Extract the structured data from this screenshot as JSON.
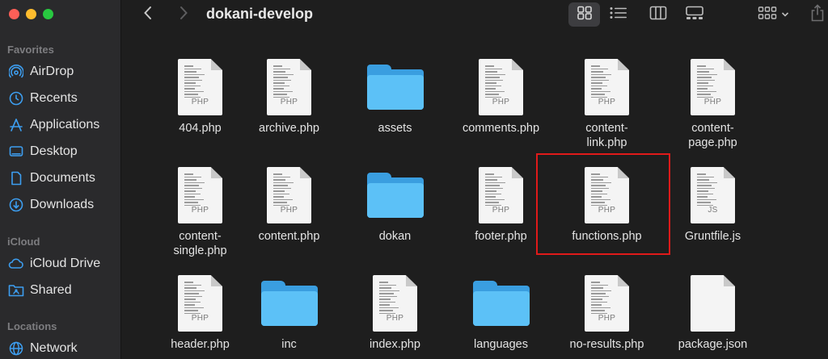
{
  "window": {
    "title": "dokani-develop"
  },
  "sidebar": {
    "favorites_label": "Favorites",
    "icloud_label": "iCloud",
    "locations_label": "Locations",
    "favorites": [
      {
        "label": "AirDrop",
        "icon": "airdrop-icon"
      },
      {
        "label": "Recents",
        "icon": "clock-icon"
      },
      {
        "label": "Applications",
        "icon": "applications-icon"
      },
      {
        "label": "Desktop",
        "icon": "desktop-icon"
      },
      {
        "label": "Documents",
        "icon": "document-icon"
      },
      {
        "label": "Downloads",
        "icon": "download-icon"
      }
    ],
    "icloud": [
      {
        "label": "iCloud Drive",
        "icon": "cloud-icon"
      },
      {
        "label": "Shared",
        "icon": "shared-folder-icon"
      }
    ],
    "locations": [
      {
        "label": "Network",
        "icon": "globe-icon"
      }
    ]
  },
  "files": [
    {
      "name": "404.php",
      "kind": "file",
      "ext": "PHP"
    },
    {
      "name": "archive.php",
      "kind": "file",
      "ext": "PHP"
    },
    {
      "name": "assets",
      "kind": "folder"
    },
    {
      "name": "comments.php",
      "kind": "file",
      "ext": "PHP"
    },
    {
      "name": "content-link.php",
      "kind": "file",
      "ext": "PHP"
    },
    {
      "name": "content-page.php",
      "kind": "file",
      "ext": "PHP"
    },
    {
      "name": "content-single.php",
      "kind": "file",
      "ext": "PHP"
    },
    {
      "name": "content.php",
      "kind": "file",
      "ext": "PHP"
    },
    {
      "name": "dokan",
      "kind": "folder"
    },
    {
      "name": "footer.php",
      "kind": "file",
      "ext": "PHP"
    },
    {
      "name": "functions.php",
      "kind": "file",
      "ext": "PHP",
      "highlighted": true
    },
    {
      "name": "Gruntfile.js",
      "kind": "file",
      "ext": "JS"
    },
    {
      "name": "header.php",
      "kind": "file",
      "ext": "PHP"
    },
    {
      "name": "inc",
      "kind": "folder"
    },
    {
      "name": "index.php",
      "kind": "file",
      "ext": "PHP"
    },
    {
      "name": "languages",
      "kind": "folder"
    },
    {
      "name": "no-results.php",
      "kind": "file",
      "ext": "PHP"
    },
    {
      "name": "package.json",
      "kind": "file",
      "ext": ""
    }
  ],
  "colors": {
    "accent": "#3a9ee0",
    "highlight_border": "#e01a1a"
  }
}
